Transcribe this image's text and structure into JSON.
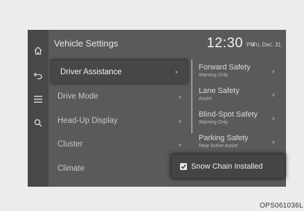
{
  "header": {
    "title": "Vehicle Settings",
    "time": "12:30",
    "ampm": "PM",
    "date": "Fri, Dec. 31"
  },
  "sidebar_icons": [
    "home-icon",
    "back-icon",
    "menu-icon",
    "search-icon"
  ],
  "menu": {
    "items": [
      {
        "label": "Driver Assistance",
        "selected": true
      },
      {
        "label": "Drive Mode",
        "selected": false
      },
      {
        "label": "Head-Up Display",
        "selected": false
      },
      {
        "label": "Cluster",
        "selected": false
      },
      {
        "label": "Climate",
        "selected": false
      }
    ]
  },
  "options": [
    {
      "label": "Forward Safety",
      "sub": "Warning Only"
    },
    {
      "label": "Lane Safety",
      "sub": "Assist"
    },
    {
      "label": "Blind-Spot Safety",
      "sub": "Warning Only"
    },
    {
      "label": "Parking Safety",
      "sub": "Rear Active Assist"
    }
  ],
  "popup": {
    "label": "Snow Chain Installed",
    "checked": true
  },
  "footer_code": "OPS061036L",
  "colors": {
    "screen_bg": "#5a5a5a",
    "rail_bg": "#484848",
    "selected_bg": "#474747",
    "page_bg": "#ececec"
  }
}
